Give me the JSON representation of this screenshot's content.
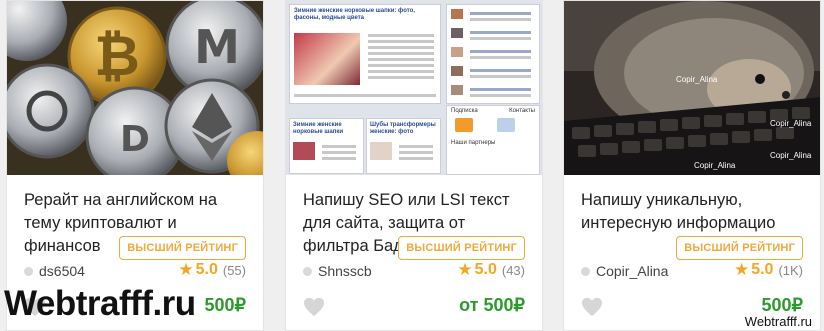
{
  "cards": [
    {
      "title": "Рерайт на английском на тему криптовалют и финансов",
      "badge": "ВЫСШИЙ РЕЙТИНГ",
      "seller": "ds6504",
      "rating": "5.0",
      "reviews": "(55)",
      "price": "500₽",
      "image": "crypto-coins-photo"
    },
    {
      "title": "Напишу SEO или LSI текст для сайта, защита от фильтра Бад",
      "badge": "ВЫСШИЙ РЕЙТИНГ",
      "seller": "Shnsscb",
      "rating": "5.0",
      "reviews": "(43)",
      "price": "от 500₽",
      "image": "website-screenshot-collage",
      "thumb_texts": {
        "headline": "Зимние женские норковые шапки: фото, фасоны, модные цвета",
        "lower_left": "Зимние женские норковые шапки",
        "lower_mid": "Шубы трансформеры женские: фото",
        "subscribe": "Подписка",
        "contacts": "Контакты",
        "partners": "Наши партнеры"
      }
    },
    {
      "title": "Напишу уникальную, интересную информацио",
      "badge": "ВЫСШИЙ РЕЙТИНГ",
      "seller": "Copir_Alina",
      "rating": "5.0",
      "reviews": "(1K)",
      "price": "500₽",
      "image": "hedgehog-on-keyboard-photo",
      "watermark": "Copir_Alina"
    }
  ],
  "watermark_left": "Webtrafff.ru",
  "watermark_right": "Webtrafff.ru",
  "colors": {
    "badge": "#f0a93b",
    "star": "#f5a623",
    "price": "#2d9a2d"
  }
}
